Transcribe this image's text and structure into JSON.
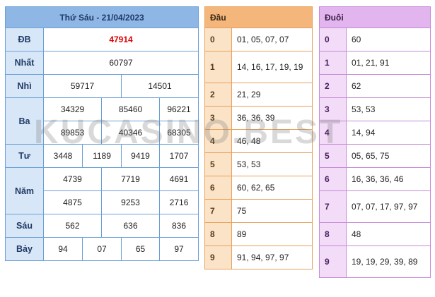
{
  "main": {
    "title": "Thứ Sáu - 21/04/2023",
    "labels": {
      "db": "ĐB",
      "nhat": "Nhất",
      "nhi": "Nhì",
      "ba": "Ba",
      "tu": "Tư",
      "nam": "Năm",
      "sau": "Sáu",
      "bay": "Bảy"
    },
    "db": "47914",
    "nhat": "60797",
    "nhi": [
      "59717",
      "14501"
    ],
    "ba": [
      "34329",
      "85460",
      "96221",
      "89853",
      "40346",
      "68305"
    ],
    "tu": [
      "3448",
      "1189",
      "9419",
      "1707"
    ],
    "nam": [
      "4739",
      "7719",
      "4691",
      "4875",
      "9253",
      "2716"
    ],
    "sau": [
      "562",
      "636",
      "836"
    ],
    "bay": [
      "94",
      "07",
      "65",
      "97"
    ]
  },
  "dau": {
    "header": "Đầu",
    "rows": [
      {
        "k": "0",
        "v": "01, 05, 07, 07"
      },
      {
        "k": "1",
        "v": "14, 16, 17, 19, 19"
      },
      {
        "k": "2",
        "v": "21, 29"
      },
      {
        "k": "3",
        "v": "36, 36, 39"
      },
      {
        "k": "4",
        "v": "46, 48"
      },
      {
        "k": "5",
        "v": "53, 53"
      },
      {
        "k": "6",
        "v": "60, 62, 65"
      },
      {
        "k": "7",
        "v": "75"
      },
      {
        "k": "8",
        "v": "89"
      },
      {
        "k": "9",
        "v": "91, 94, 97, 97"
      }
    ]
  },
  "duoi": {
    "header": "Đuôi",
    "rows": [
      {
        "k": "0",
        "v": "60"
      },
      {
        "k": "1",
        "v": "01, 21, 91"
      },
      {
        "k": "2",
        "v": "62"
      },
      {
        "k": "3",
        "v": "53, 53"
      },
      {
        "k": "4",
        "v": "14, 94"
      },
      {
        "k": "5",
        "v": "05, 65, 75"
      },
      {
        "k": "6",
        "v": "16, 36, 36, 46"
      },
      {
        "k": "7",
        "v": "07, 07, 17, 97, 97"
      },
      {
        "k": "8",
        "v": "48"
      },
      {
        "k": "9",
        "v": "19, 19, 29, 39, 89"
      }
    ]
  },
  "watermark": "KUCASINO.BEST"
}
